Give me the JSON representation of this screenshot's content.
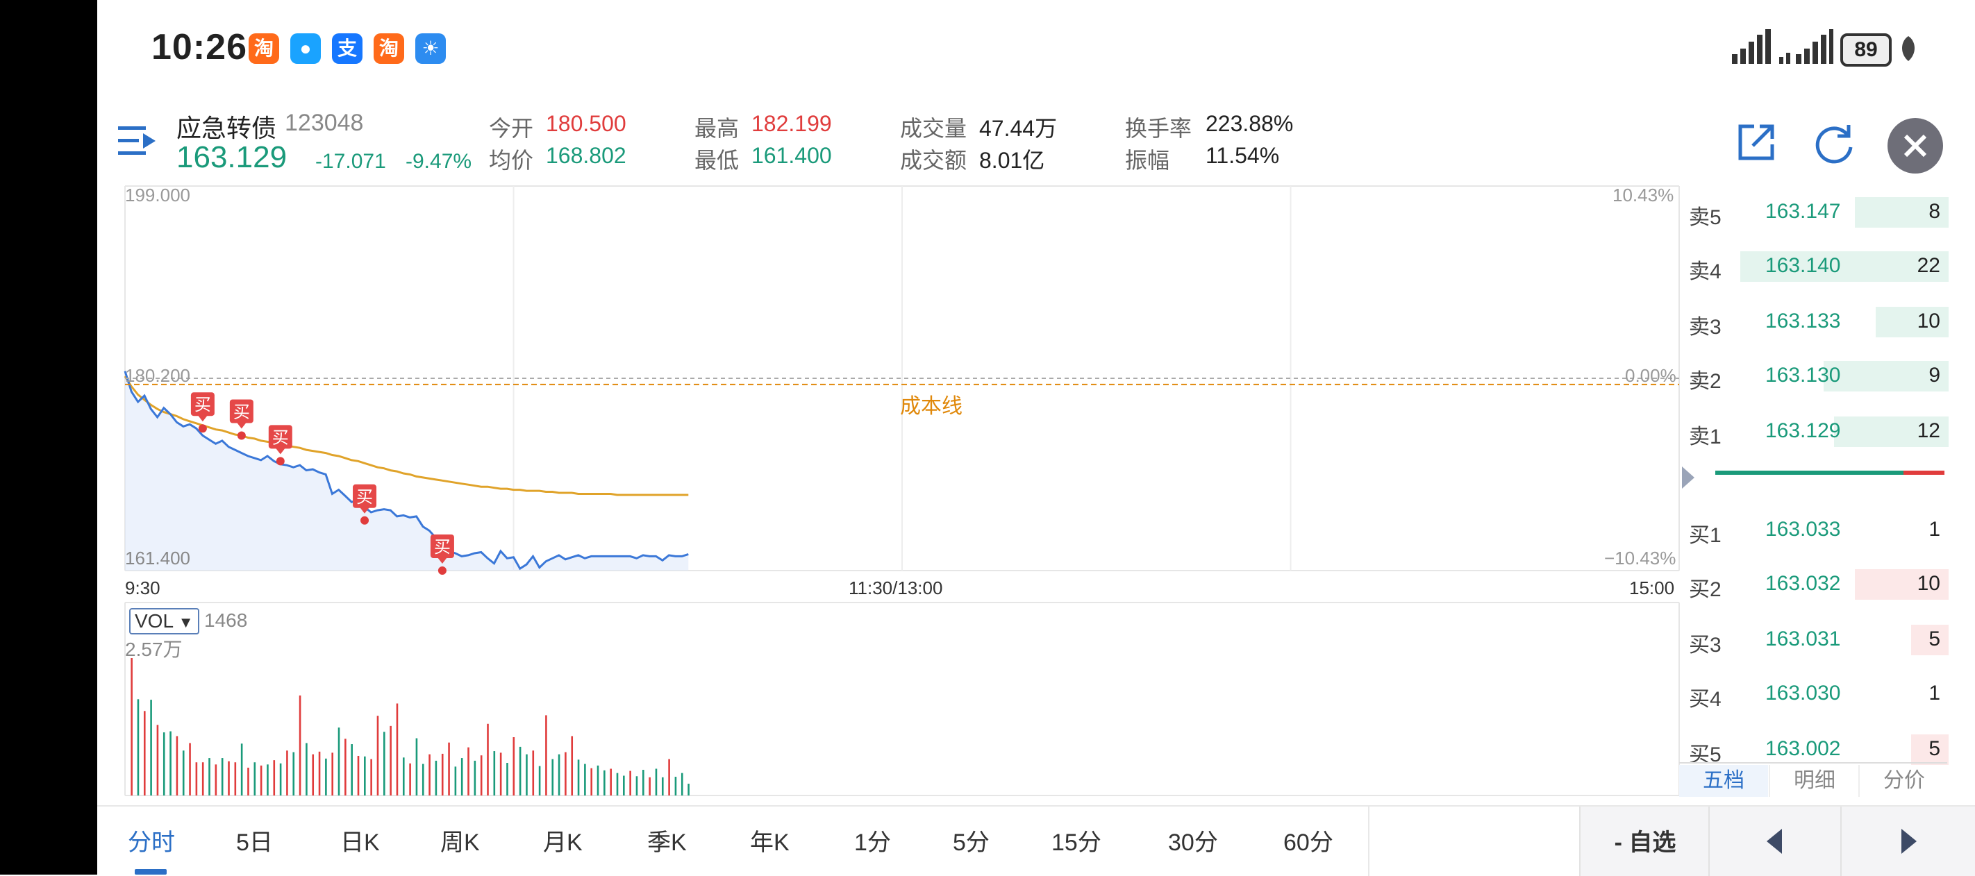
{
  "status_bar": {
    "time": "10:26",
    "apps": [
      {
        "icon": "taobao-icon",
        "glyph": "淘",
        "color": "#ff6a1a"
      },
      {
        "icon": "message-icon",
        "glyph": "●",
        "color": "#1aa3ff"
      },
      {
        "icon": "alipay-icon",
        "glyph": "支",
        "color": "#1677ff"
      },
      {
        "icon": "taobao-icon",
        "glyph": "淘",
        "color": "#ff6a1a"
      },
      {
        "icon": "weather-icon",
        "glyph": "☀",
        "color": "#2d8cf0"
      }
    ],
    "battery": "89"
  },
  "header": {
    "name": "应急转债",
    "code": "123048",
    "price": "163.129",
    "change": "-17.071",
    "change_pct": "-9.47%",
    "quotes": {
      "open_label": "今开",
      "open": "180.500",
      "avg_label": "均价",
      "avg": "168.802",
      "high_label": "最高",
      "high": "182.199",
      "low_label": "最低",
      "low": "161.400",
      "vol_label": "成交量",
      "vol": "47.44万",
      "amt_label": "成交额",
      "amt": "8.01亿",
      "turnover_label": "换手率",
      "turnover": "223.88%",
      "amplitude_label": "振幅",
      "amplitude": "11.54%"
    }
  },
  "chart_data": {
    "type": "line",
    "y_max_label": "199.000",
    "y_ref_label": "180.200",
    "y_min_label": "161.400",
    "pct_max_label": "10.43%",
    "pct_ref_label": "0.00%",
    "pct_min_label": "−10.43%",
    "ylim": [
      161.4,
      199.0
    ],
    "reference": 180.2,
    "cost_line_label": "成本线",
    "cost_line_value": 179.6,
    "x_labels": [
      "9:30",
      "11:30/13:00",
      "15:00"
    ],
    "buy_marker_label": "买",
    "price": [
      180.9,
      178.9,
      177.9,
      178.5,
      177.2,
      176.4,
      177.3,
      176.7,
      175.9,
      175.5,
      175.7,
      175.3,
      174.6,
      174.2,
      173.8,
      174.1,
      173.5,
      173.2,
      172.9,
      172.6,
      172.4,
      172.2,
      172.6,
      172.1,
      171.8,
      171.7,
      171.5,
      171.7,
      171.2,
      171.3,
      171.0,
      170.8,
      168.9,
      169.3,
      168.7,
      168.1,
      168.3,
      167.6,
      167.1,
      167.3,
      167.4,
      167.3,
      166.7,
      166.8,
      166.6,
      166.7,
      165.7,
      165.3,
      164.6,
      163.9,
      163.3,
      163.1,
      162.8,
      162.9,
      163.1,
      163.2,
      162.6,
      162.1,
      163.3,
      162.6,
      162.7,
      161.6,
      162.0,
      162.8,
      161.7,
      162.3,
      162.6,
      162.9,
      162.5,
      162.7,
      162.9,
      162.6,
      162.8,
      162.8,
      162.8,
      162.8,
      162.8,
      162.8,
      162.8,
      162.6,
      162.9,
      162.8,
      162.8,
      162.4,
      162.9,
      162.8,
      162.8,
      163.0
    ],
    "avg": [
      180.4,
      179.4,
      178.6,
      178.1,
      177.6,
      177.2,
      176.9,
      176.7,
      176.5,
      176.2,
      176.0,
      175.8,
      175.6,
      175.4,
      175.2,
      175.1,
      174.9,
      174.7,
      174.6,
      174.4,
      174.3,
      174.1,
      174.0,
      173.9,
      173.7,
      173.6,
      173.5,
      173.4,
      173.2,
      173.1,
      173.0,
      172.9,
      172.7,
      172.6,
      172.4,
      172.2,
      172.1,
      171.9,
      171.7,
      171.5,
      171.4,
      171.2,
      171.1,
      170.9,
      170.8,
      170.6,
      170.5,
      170.4,
      170.3,
      170.2,
      170.1,
      170.0,
      169.9,
      169.8,
      169.7,
      169.6,
      169.6,
      169.5,
      169.4,
      169.4,
      169.3,
      169.3,
      169.2,
      169.2,
      169.2,
      169.1,
      169.1,
      169.0,
      169.0,
      169.0,
      168.9,
      168.9,
      168.9,
      168.9,
      168.9,
      168.9,
      168.8,
      168.8,
      168.8,
      168.8,
      168.8,
      168.8,
      168.8,
      168.8,
      168.8,
      168.8,
      168.8,
      168.8
    ],
    "buy_markers": [
      {
        "idx": 12,
        "price": 175.3
      },
      {
        "idx": 18,
        "price": 174.6
      },
      {
        "idx": 24,
        "price": 172.1
      },
      {
        "idx": 37,
        "price": 166.3
      },
      {
        "idx": 49,
        "price": 161.4
      }
    ],
    "volume": {
      "label": "VOL",
      "current": "1468",
      "max_label": "2.57万",
      "max": 25700,
      "bars": [
        25700,
        18000,
        15800,
        17900,
        13200,
        11800,
        12000,
        11100,
        8400,
        9800,
        6200,
        6200,
        7000,
        5800,
        7000,
        6400,
        6200,
        9700,
        5200,
        6200,
        5600,
        5800,
        6600,
        6000,
        8400,
        8100,
        18700,
        9800,
        7700,
        8200,
        6900,
        8000,
        12700,
        10600,
        9600,
        7400,
        7300,
        6800,
        14900,
        11900,
        13000,
        17200,
        7100,
        6000,
        10700,
        5900,
        7700,
        6500,
        7800,
        9900,
        5400,
        7000,
        9000,
        6500,
        7500,
        13400,
        8300,
        8000,
        6100,
        10900,
        9100,
        7700,
        8400,
        5500,
        15000,
        6800,
        7700,
        8100,
        11100,
        6700,
        5900,
        5100,
        5600,
        4700,
        5000,
        4200,
        3700,
        4600,
        3600,
        4800,
        3400,
        5000,
        3400,
        6800,
        3500,
        4200,
        2200
      ],
      "bar_up": [
        true,
        false,
        true,
        false,
        true,
        false,
        false,
        true,
        false,
        true,
        true,
        true,
        false,
        true,
        false,
        true,
        true,
        false,
        true,
        false,
        true,
        false,
        true,
        false,
        true,
        false,
        true,
        false,
        true,
        true,
        false,
        true,
        false,
        true,
        false,
        true,
        false,
        true,
        true,
        false,
        true,
        true,
        false,
        true,
        false,
        false,
        true,
        false,
        true,
        true,
        false,
        false,
        true,
        false,
        true,
        true,
        false,
        true,
        false,
        true,
        false,
        false,
        true,
        false,
        true,
        false,
        false,
        true,
        true,
        false,
        false,
        true,
        false,
        false,
        true,
        false,
        false,
        true,
        false,
        false,
        true,
        false,
        false,
        true,
        false,
        false,
        false
      ]
    }
  },
  "orderbook": {
    "rows": [
      {
        "label": "卖5",
        "price": "163.147",
        "vol": "8",
        "side": "sell",
        "bar": 0.45
      },
      {
        "label": "卖4",
        "price": "163.140",
        "vol": "22",
        "side": "sell",
        "bar": 1.0
      },
      {
        "label": "卖3",
        "price": "163.133",
        "vol": "10",
        "side": "sell",
        "bar": 0.35
      },
      {
        "label": "卖2",
        "price": "163.130",
        "vol": "9",
        "side": "sell",
        "bar": 0.6
      },
      {
        "label": "卖1",
        "price": "163.129",
        "vol": "12",
        "side": "sell",
        "bar": 0.55
      },
      {
        "label": "买1",
        "price": "163.033",
        "vol": "1",
        "side": "buy",
        "bar": 0.0
      },
      {
        "label": "买2",
        "price": "163.032",
        "vol": "10",
        "side": "buy",
        "bar": 0.45
      },
      {
        "label": "买3",
        "price": "163.031",
        "vol": "5",
        "side": "buy",
        "bar": 0.18
      },
      {
        "label": "买4",
        "price": "163.030",
        "vol": "1",
        "side": "buy",
        "bar": 0.0
      },
      {
        "label": "买5",
        "price": "163.002",
        "vol": "5",
        "side": "buy",
        "bar": 0.18
      }
    ],
    "sell_ratio": 0.82,
    "tabs": [
      "五档",
      "明细",
      "分价"
    ]
  },
  "bottom_tabs": [
    "分时",
    "5日",
    "日K",
    "周K",
    "月K",
    "季K",
    "年K",
    "1分",
    "5分",
    "15分",
    "30分",
    "60分"
  ],
  "watchlist_label": "- 自选",
  "colors": {
    "up": "#e03c3c",
    "down": "#1a9a7a",
    "price_line": "#3b78d8",
    "avg_line": "#e0a32a",
    "cost_line": "#e0880a"
  }
}
